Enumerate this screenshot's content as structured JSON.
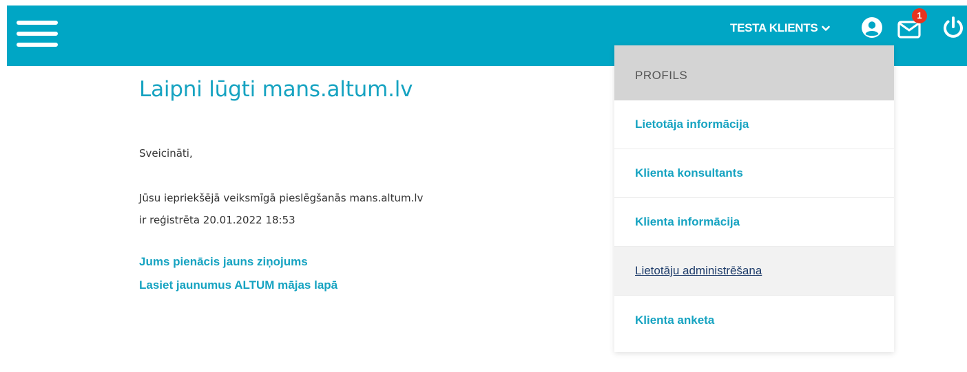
{
  "header": {
    "user_name": "TESTA KLIENTS",
    "notification_count": "1",
    "icons": [
      "menu-icon",
      "chevron-down-icon",
      "user-icon",
      "mail-icon",
      "power-icon"
    ],
    "color": "#00a6c5"
  },
  "main": {
    "title": "Laipni lūgti mans.altum.lv",
    "greeting": "Sveicināti,",
    "last_login_line1": "Jūsu iepriekšējā veiksmīgā pieslēgšanās mans.altum.lv",
    "last_login_line2": "ir reģistrēta 20.01.2022 18:53",
    "links": [
      {
        "label": "Jums pienācis jauns ziņojums"
      },
      {
        "label": "Lasiet jaunumus ALTUM mājas lapā"
      }
    ]
  },
  "dropdown": {
    "header": "PROFILS",
    "items": [
      {
        "label": "Lietotāja informācija",
        "active": false
      },
      {
        "label": "Klienta konsultants",
        "active": false
      },
      {
        "label": "Klienta informācija",
        "active": false
      },
      {
        "label": "Lietotāju administrēšana",
        "active": true
      },
      {
        "label": "Klienta anketa",
        "active": false
      }
    ]
  },
  "colors": {
    "accent": "#16a3c1",
    "badge": "#e8331f",
    "dropdown_header_bg": "#d4d4d4",
    "active_item_text": "#1f3d6b"
  }
}
